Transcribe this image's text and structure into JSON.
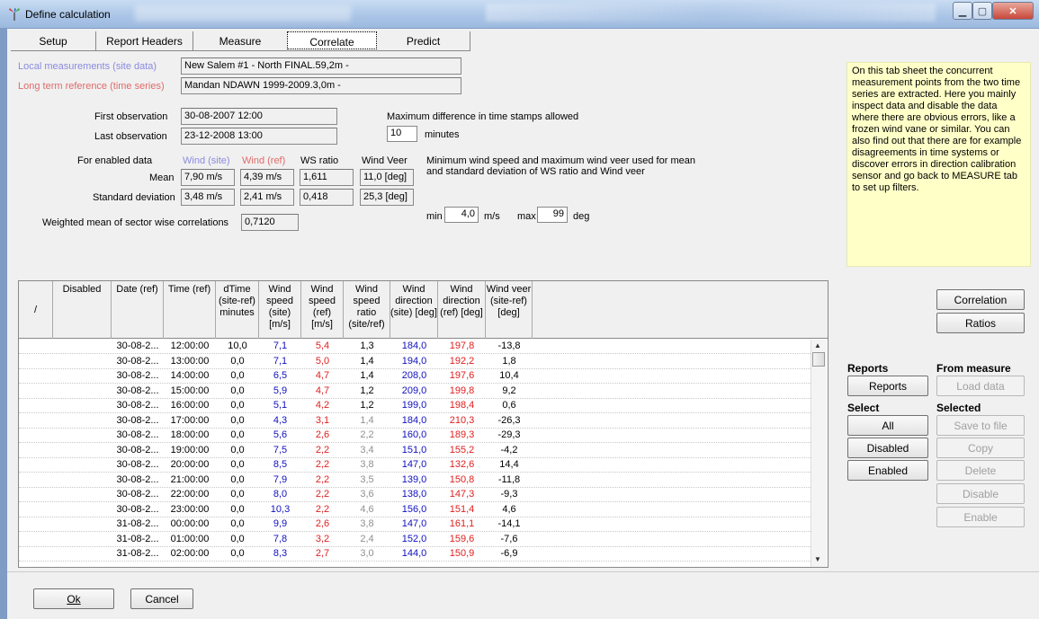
{
  "window": {
    "title": "Define calculation"
  },
  "tabs": [
    {
      "label": "Setup"
    },
    {
      "label": "Report Headers"
    },
    {
      "label": "Measure"
    },
    {
      "label": "Correlate"
    },
    {
      "label": "Predict"
    }
  ],
  "site": {
    "label": "Local measurements (site data)",
    "value": "New Salem #1 - North FINAL.59,2m -"
  },
  "reference": {
    "label": "Long term reference (time series)",
    "value": "Mandan NDAWN 1999-2009.3,0m -"
  },
  "observations": {
    "first_label": "First observation",
    "first_value": "30-08-2007 12:00",
    "last_label": "Last observation",
    "last_value": "23-12-2008 13:00"
  },
  "timestamp": {
    "label": "Maximum difference in time stamps allowed",
    "value": "10",
    "unit": "minutes"
  },
  "stats": {
    "enabled_label": "For enabled data",
    "col_site": "Wind (site)",
    "col_ref": "Wind (ref)",
    "col_ratio": "WS ratio",
    "col_veer": "Wind Veer",
    "mean_label": "Mean",
    "mean_site": "7,90 m/s",
    "mean_ref": "4,39 m/s",
    "mean_ratio": "1,611",
    "mean_veer": "11,0 [deg]",
    "sd_label": "Standard deviation",
    "sd_site": "3,48 m/s",
    "sd_ref": "2,41 m/s",
    "sd_ratio": "0,418",
    "sd_veer": "25,3 [deg]",
    "weighted_label": "Weighted mean of sector wise correlations",
    "weighted_value": "0,7120"
  },
  "minmax": {
    "desc": "Minimum wind speed and maximum wind veer used for mean and standard deviation of WS ratio and Wind veer",
    "min_label": "min",
    "min_value": "4,0",
    "min_unit": "m/s",
    "max_label": "max",
    "max_value": "99",
    "max_unit": "deg"
  },
  "help_text": "On this tab sheet the concurrent measurement points from the two time series are extracted. Here you mainly inspect data and disable the data where there are obvious errors, like a frozen wind vane or similar. You can also find out that there are for example disagreements in time systems or discover errors in direction calibration sensor and go back to MEASURE tab to set up filters.",
  "table": {
    "sort_glyph": "/",
    "headers": [
      "Disabled",
      "Date (ref)",
      "Time (ref)",
      "dTime (site-ref) minutes",
      "Wind speed (site) [m/s]",
      "Wind speed (ref) [m/s]",
      "Wind speed ratio (site/ref)",
      "Wind direction (site) [deg]",
      "Wind direction (ref) [deg]",
      "Wind veer (site-ref) [deg]"
    ],
    "rows": [
      [
        "",
        "30-08-2...",
        "12:00:00",
        "10,0",
        "7,1",
        "5,4",
        "1,3",
        "184,0",
        "197,8",
        "-13,8"
      ],
      [
        "",
        "30-08-2...",
        "13:00:00",
        "0,0",
        "7,1",
        "5,0",
        "1,4",
        "194,0",
        "192,2",
        "1,8"
      ],
      [
        "",
        "30-08-2...",
        "14:00:00",
        "0,0",
        "6,5",
        "4,7",
        "1,4",
        "208,0",
        "197,6",
        "10,4"
      ],
      [
        "",
        "30-08-2...",
        "15:00:00",
        "0,0",
        "5,9",
        "4,7",
        "1,2",
        "209,0",
        "199,8",
        "9,2"
      ],
      [
        "",
        "30-08-2...",
        "16:00:00",
        "0,0",
        "5,1",
        "4,2",
        "1,2",
        "199,0",
        "198,4",
        "0,6"
      ],
      [
        "",
        "30-08-2...",
        "17:00:00",
        "0,0",
        "4,3",
        "3,1",
        "1,4",
        "184,0",
        "210,3",
        "-26,3"
      ],
      [
        "",
        "30-08-2...",
        "18:00:00",
        "0,0",
        "5,6",
        "2,6",
        "2,2",
        "160,0",
        "189,3",
        "-29,3"
      ],
      [
        "",
        "30-08-2...",
        "19:00:00",
        "0,0",
        "7,5",
        "2,2",
        "3,4",
        "151,0",
        "155,2",
        "-4,2"
      ],
      [
        "",
        "30-08-2...",
        "20:00:00",
        "0,0",
        "8,5",
        "2,2",
        "3,8",
        "147,0",
        "132,6",
        "14,4"
      ],
      [
        "",
        "30-08-2...",
        "21:00:00",
        "0,0",
        "7,9",
        "2,2",
        "3,5",
        "139,0",
        "150,8",
        "-11,8"
      ],
      [
        "",
        "30-08-2...",
        "22:00:00",
        "0,0",
        "8,0",
        "2,2",
        "3,6",
        "138,0",
        "147,3",
        "-9,3"
      ],
      [
        "",
        "30-08-2...",
        "23:00:00",
        "0,0",
        "10,3",
        "2,2",
        "4,6",
        "156,0",
        "151,4",
        "4,6"
      ],
      [
        "",
        "31-08-2...",
        "00:00:00",
        "0,0",
        "9,9",
        "2,6",
        "3,8",
        "147,0",
        "161,1",
        "-14,1"
      ],
      [
        "",
        "31-08-2...",
        "01:00:00",
        "0,0",
        "7,8",
        "3,2",
        "2,4",
        "152,0",
        "159,6",
        "-7,6"
      ],
      [
        "",
        "31-08-2...",
        "02:00:00",
        "0,0",
        "8,3",
        "2,7",
        "3,0",
        "144,0",
        "150,9",
        "-6,9"
      ]
    ]
  },
  "right_buttons": {
    "correlation": "Correlation",
    "ratios": "Ratios",
    "reports_header": "Reports",
    "reports": "Reports",
    "from_measure_header": "From measure",
    "load_data": "Load data",
    "select_header": "Select",
    "all": "All",
    "disabled": "Disabled",
    "enabled": "Enabled",
    "selected_header": "Selected",
    "save_to_file": "Save to file",
    "copy": "Copy",
    "delete": "Delete",
    "disable": "Disable",
    "enable": "Enable"
  },
  "footer": {
    "ok": "Ok",
    "cancel": "Cancel"
  },
  "colors": {
    "site": "#1010c0",
    "ref": "#e02020",
    "ratio_gray": "#909090"
  }
}
